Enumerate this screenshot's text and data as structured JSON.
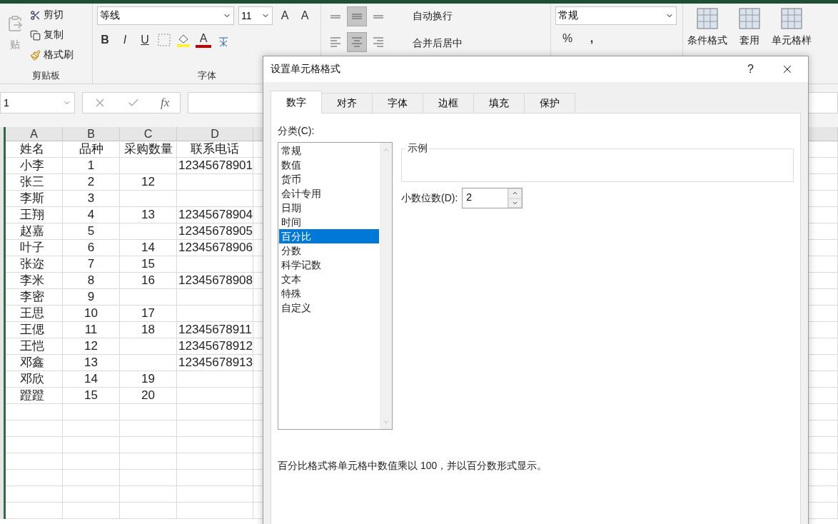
{
  "ribbon": {
    "clipboard": {
      "paste": "贴",
      "cut": "剪切",
      "copy": "复制",
      "format_painter": "格式刷",
      "label": "剪贴板"
    },
    "font": {
      "font_name": "等线",
      "font_size": "11",
      "grow": "A",
      "shrink": "A",
      "bold": "B",
      "italic": "I",
      "underline": "U",
      "font_color": "A",
      "label": "字体"
    },
    "alignment": {
      "vertical": [
        {
          "kind": "top",
          "selected": false
        },
        {
          "kind": "middle",
          "selected": true
        },
        {
          "kind": "bottom",
          "selected": false
        }
      ],
      "horizontal": [
        {
          "kind": "left",
          "selected": false
        },
        {
          "kind": "center",
          "selected": true
        },
        {
          "kind": "right",
          "selected": false
        }
      ],
      "wrap_text": "自动换行",
      "merge_center": "合并后居中"
    },
    "number": {
      "format": "常规",
      "percent": "%",
      "comma": ","
    },
    "styles": {
      "conditional": "条件格式",
      "table": "套用",
      "cell_styles": "单元格样"
    }
  },
  "formula_bar": {
    "name_box": "1",
    "fx": "fx"
  },
  "sheet": {
    "columns": [
      "A",
      "B",
      "C",
      "D"
    ],
    "rows": [
      [
        "姓名",
        "品种",
        "采购数量",
        "联系电话"
      ],
      [
        "小李",
        "1",
        "",
        "12345678901"
      ],
      [
        "张三",
        "2",
        "12",
        ""
      ],
      [
        "李斯",
        "3",
        "",
        ""
      ],
      [
        "王翔",
        "4",
        "13",
        "12345678904"
      ],
      [
        "赵嘉",
        "5",
        "",
        "12345678905"
      ],
      [
        "叶子",
        "6",
        "14",
        "12345678906"
      ],
      [
        "张迩",
        "7",
        "15",
        ""
      ],
      [
        "李米",
        "8",
        "16",
        "12345678908"
      ],
      [
        "李密",
        "9",
        "",
        ""
      ],
      [
        "王思",
        "10",
        "17",
        ""
      ],
      [
        "王偲",
        "11",
        "18",
        "12345678911"
      ],
      [
        "王恺",
        "12",
        "",
        "12345678912"
      ],
      [
        "邓鑫",
        "13",
        "",
        "12345678913"
      ],
      [
        "邓欣",
        "14",
        "19",
        ""
      ],
      [
        "蹬蹬",
        "15",
        "20",
        ""
      ]
    ]
  },
  "dialog": {
    "title": "设置单元格格式",
    "help": "?",
    "tabs": [
      {
        "label": "数字",
        "selected": true
      },
      {
        "label": "对齐",
        "selected": false
      },
      {
        "label": "字体",
        "selected": false
      },
      {
        "label": "边框",
        "selected": false
      },
      {
        "label": "填充",
        "selected": false
      },
      {
        "label": "保护",
        "selected": false
      }
    ],
    "category_label": "分类(C):",
    "categories": [
      {
        "label": "常规",
        "selected": false
      },
      {
        "label": "数值",
        "selected": false
      },
      {
        "label": "货币",
        "selected": false
      },
      {
        "label": "会计专用",
        "selected": false
      },
      {
        "label": "日期",
        "selected": false
      },
      {
        "label": "时间",
        "selected": false
      },
      {
        "label": "百分比",
        "selected": true
      },
      {
        "label": "分数",
        "selected": false
      },
      {
        "label": "科学记数",
        "selected": false
      },
      {
        "label": "文本",
        "selected": false
      },
      {
        "label": "特殊",
        "selected": false
      },
      {
        "label": "自定义",
        "selected": false
      }
    ],
    "sample_label": "示例",
    "decimal_label": "小数位数(D):",
    "decimal_value": "2",
    "description": "百分比格式将单元格中数值乘以 100，并以百分数形式显示。"
  }
}
